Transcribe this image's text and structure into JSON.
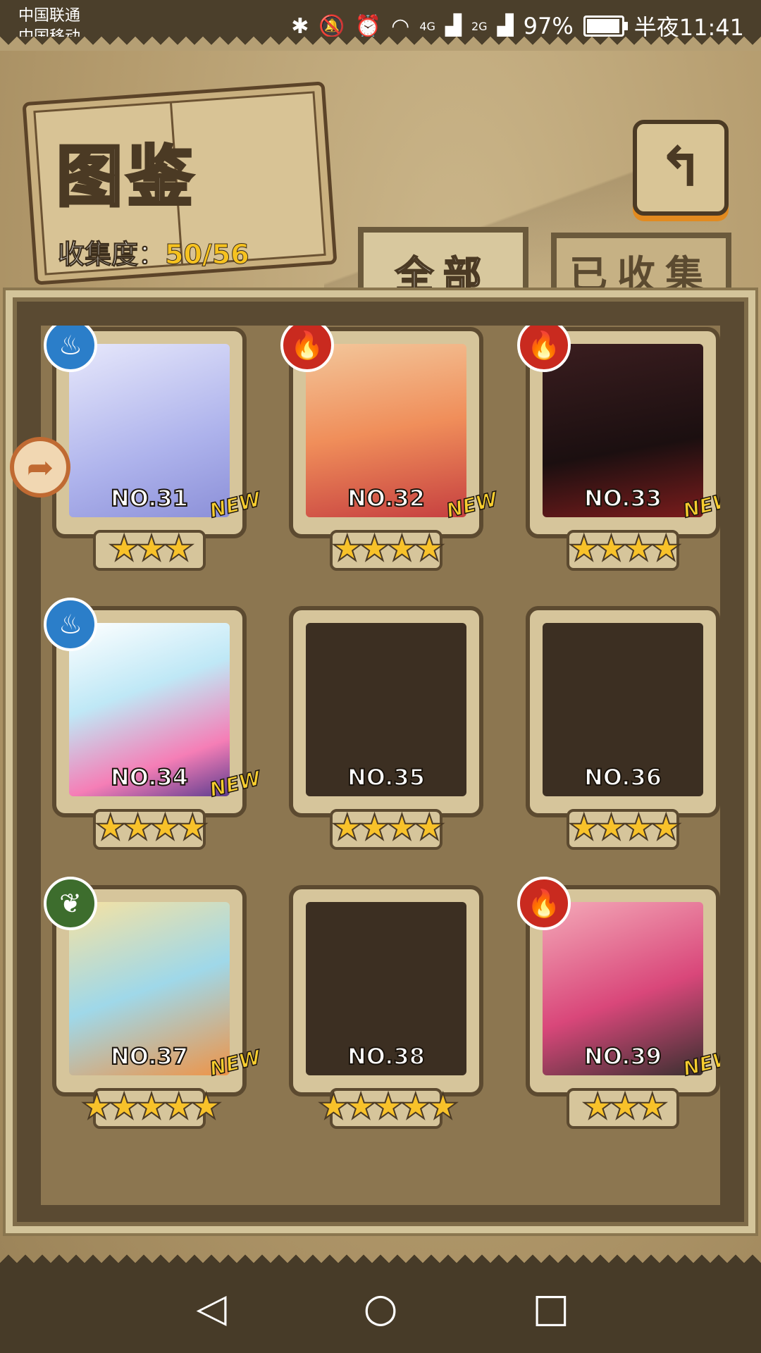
{
  "status_bar": {
    "carrier_1": "中国联通",
    "carrier_2": "中国移动",
    "net_1": "4G",
    "net_2": "2G",
    "battery": "97%",
    "battery_level": 0.97,
    "time": "半夜11:41",
    "icons": [
      "bluetooth-icon",
      "mute-icon",
      "alarm-icon",
      "wifi-icon",
      "signal-icon",
      "signal-icon",
      "battery-icon"
    ]
  },
  "header": {
    "title": "图鉴",
    "collection_label": "收集度：",
    "collection_value": "50/56",
    "back_icon": "return-icon"
  },
  "tabs": [
    {
      "label": "全部",
      "active": true
    },
    {
      "label": "已收集",
      "active": false
    }
  ],
  "cards": [
    {
      "no": "NO.31",
      "stars": "★★★",
      "new": "NEW",
      "element": "water",
      "collected": true
    },
    {
      "no": "NO.32",
      "stars": "★★★★",
      "new": "NEW",
      "element": "fire",
      "collected": true
    },
    {
      "no": "NO.33",
      "stars": "★★★★",
      "new": "NEW",
      "element": "fire",
      "collected": true
    },
    {
      "no": "NO.34",
      "stars": "★★★★",
      "new": "NEW",
      "element": "water",
      "collected": true
    },
    {
      "no": "NO.35",
      "stars": "★★★★",
      "new": "",
      "element": "",
      "collected": false
    },
    {
      "no": "NO.36",
      "stars": "★★★★",
      "new": "",
      "element": "",
      "collected": false
    },
    {
      "no": "NO.37",
      "stars": "★★★★★",
      "new": "NEW",
      "element": "nature",
      "collected": true
    },
    {
      "no": "NO.38",
      "stars": "★★★★★",
      "new": "",
      "element": "",
      "collected": false
    },
    {
      "no": "NO.39",
      "stars": "★★★",
      "new": "NEW",
      "element": "fire",
      "collected": true
    }
  ],
  "glyphs": {
    "water": "♨",
    "fire": "🔥",
    "nature": "❦",
    "back": "↰",
    "side_arrow": "➦",
    "nav_back": "◁",
    "nav_home": "○",
    "nav_recent": "□"
  },
  "colors": {
    "star": "#f8c22a",
    "new_badge": "#f7cd2f",
    "collection_value": "#f6c21f",
    "water": "#2b7ec9",
    "fire": "#c92a1f",
    "nature": "#3d6d2d"
  }
}
